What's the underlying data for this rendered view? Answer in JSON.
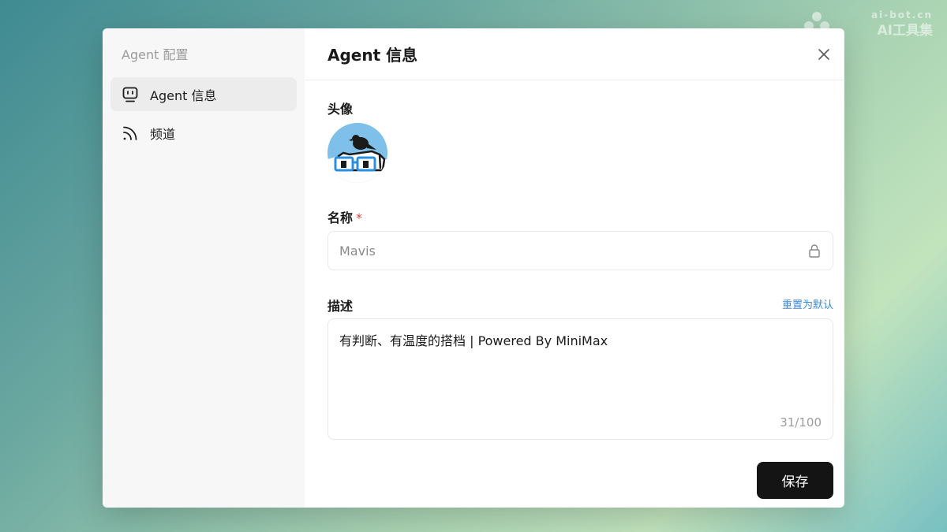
{
  "watermark": {
    "line1": "ai-bot.cn",
    "line2": "AI工具集"
  },
  "sidebar": {
    "title": "Agent 配置",
    "items": [
      {
        "label": "Agent 信息",
        "icon": "robot-icon",
        "active": true
      },
      {
        "label": "频道",
        "icon": "rss-icon",
        "active": false
      }
    ]
  },
  "header": {
    "title": "Agent 信息",
    "close_icon": "close-icon"
  },
  "form": {
    "avatar_label": "头像",
    "name_label": "名称",
    "required_mark": "*",
    "name_value": "Mavis",
    "desc_label": "描述",
    "reset_label": "重置为默认",
    "desc_value": "有判断、有温度的搭档 | Powered By MiniMax",
    "counter": "31/100",
    "save_label": "保存"
  },
  "colors": {
    "accent_link": "#3b8ad9",
    "primary_button": "#141414",
    "required": "#e0453d",
    "avatar_bg": "#7ec0ea"
  }
}
